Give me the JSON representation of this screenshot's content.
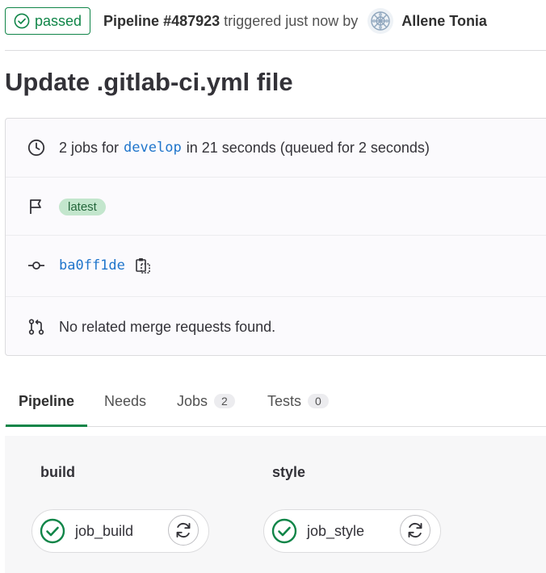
{
  "header": {
    "status_label": "passed",
    "pipeline_label": "Pipeline #487923",
    "triggered_text": "triggered just now by",
    "author_name": "Allene Tonia"
  },
  "commit": {
    "title": "Update .gitlab-ci.yml file"
  },
  "info": {
    "jobs_prefix": "2 jobs for",
    "branch": "develop",
    "duration_text": "in 21 seconds (queued for 2 seconds)",
    "badge": "latest",
    "sha": "ba0ff1de",
    "merge_requests_text": "No related merge requests found."
  },
  "tabs": [
    {
      "label": "Pipeline",
      "active": true
    },
    {
      "label": "Needs"
    },
    {
      "label": "Jobs",
      "count": "2"
    },
    {
      "label": "Tests",
      "count": "0"
    }
  ],
  "stages": [
    {
      "name": "build",
      "job": "job_build",
      "status": "passed"
    },
    {
      "name": "style",
      "job": "job_style",
      "status": "passed"
    }
  ],
  "colors": {
    "success": "#108548",
    "link": "#1f75cb",
    "badge_bg": "#c3e6cd"
  },
  "icons": {
    "status": "check-circle-icon",
    "clock": "clock-icon",
    "flag": "flag-icon",
    "commit": "commit-icon",
    "merge_request": "merge-request-icon",
    "copy": "copy-to-clipboard-icon",
    "retry": "retry-icon"
  }
}
